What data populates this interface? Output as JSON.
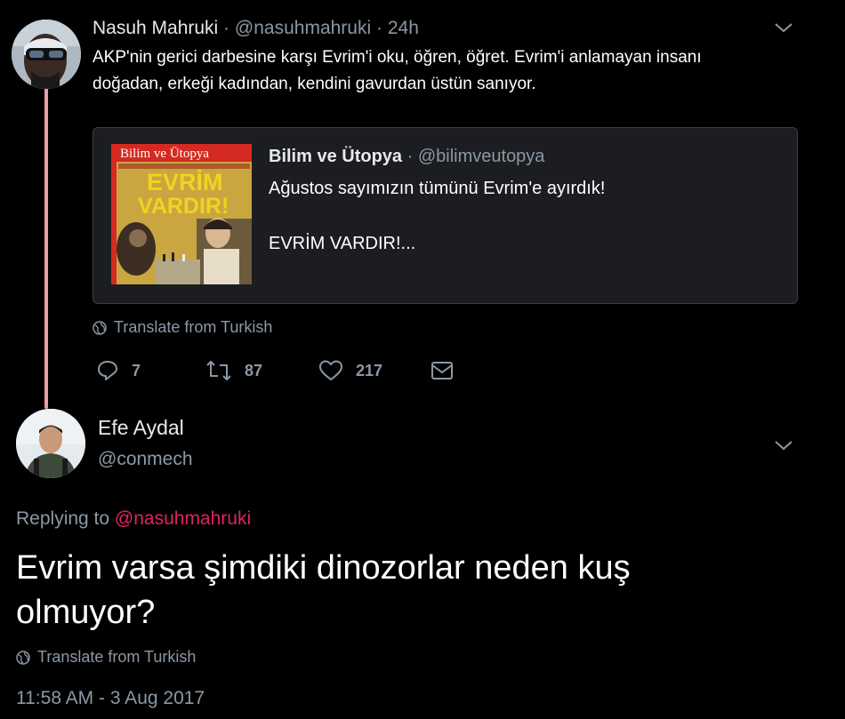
{
  "original_tweet": {
    "author_name": "Nasuh Mahruki",
    "separator": "·",
    "handle": "@nasuhmahruki",
    "time_ago": "24h",
    "text_line1": "AKP'nin gerici darbesine karşı Evrim'i oku, öğren, öğret. Evrim'i anlamayan insanı",
    "text_line2": "doğadan, erkeği kadından, kendini gavurdan üstün sanıyor.",
    "translate_label": "Translate from Turkish",
    "actions": {
      "replies": "7",
      "retweets": "87",
      "likes": "217"
    },
    "icons": [
      "chevron-down-icon",
      "reply-icon",
      "retweet-icon",
      "heart-icon",
      "mail-icon",
      "globe-icon"
    ]
  },
  "quoted_tweet": {
    "author_name": "Bilim ve Ütopya",
    "separator": "·",
    "handle": "@bilimveutopya",
    "text_line1": "Ağustos sayımızın tümünü Evrim'e ayırdık!",
    "text_line2": "EVRİM VARDIR!...",
    "image_masthead": "Bilim ve Ütopya",
    "image_headline_1": "EVRİM",
    "image_headline_2": "VARDIR!"
  },
  "reply_tweet": {
    "author_name": "Efe Aydal",
    "handle": "@conmech",
    "replying_prefix": "Replying to",
    "replying_to": "@nasuhmahruki",
    "text_line1": "Evrim varsa şimdiki dinozorlar neden kuş",
    "text_line2": "olmuyor?",
    "translate_label": "Translate from Turkish",
    "timestamp": "11:58 AM - 3 Aug 2017"
  },
  "colors": {
    "background": "#000000",
    "muted_text": "#8b98a5",
    "thread_line": "#e8a0a4",
    "mention": "#e0245e",
    "quote_background": "#1b1d20",
    "quote_border": "#3a3f44"
  }
}
